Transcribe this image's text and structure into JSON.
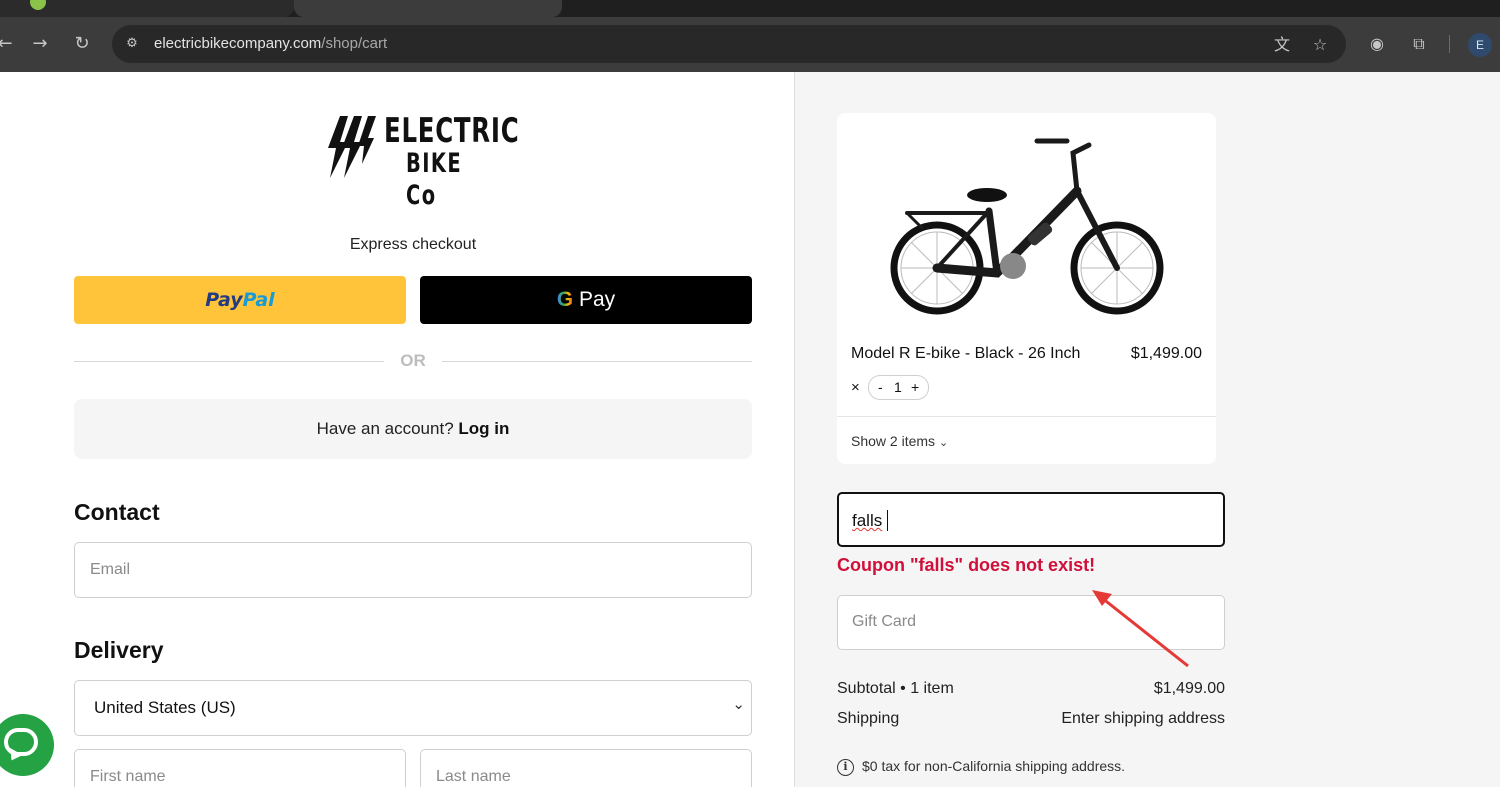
{
  "browser": {
    "url_domain": "electricbikecompany.com",
    "url_path": "/shop/cart",
    "profile_initial": "E"
  },
  "brand": {
    "logo_line1": "ELECTRIC",
    "logo_line2": "BIKE Co",
    "color": "#111111"
  },
  "checkout": {
    "express_label": "Express checkout",
    "paypal_label_a": "Pay",
    "paypal_label_b": "Pal",
    "gpay_g": "G",
    "gpay_label": "Pay",
    "or_label": "OR",
    "account_prompt": "Have an account?",
    "login_label": "Log in"
  },
  "contact": {
    "title": "Contact",
    "email_placeholder": "Email"
  },
  "delivery": {
    "title": "Delivery",
    "country_value": "United States (US)",
    "first_name_placeholder": "First name",
    "last_name_placeholder": "Last name"
  },
  "cart": {
    "product_name": "Model R E-bike - Black - 26 Inch",
    "product_price": "$1,499.00",
    "qty_prefix": "×",
    "qty_minus": "-",
    "qty_value": "1",
    "qty_plus": "+",
    "show_items": "Show 2 items"
  },
  "coupon": {
    "value": "falls",
    "error": "Coupon \"falls\" does not exist!",
    "error_color": "#d0103a"
  },
  "gift_card": {
    "placeholder": "Gift Card"
  },
  "summary": {
    "subtotal_label": "Subtotal • 1 item",
    "subtotal_value": "$1,499.00",
    "shipping_label": "Shipping",
    "shipping_value": "Enter shipping address",
    "tax_note": "$0 tax for non-California shipping address."
  },
  "colors": {
    "paypal_yellow": "#ffc439",
    "chat_green": "#25a244",
    "annotation_red": "#e53935"
  }
}
